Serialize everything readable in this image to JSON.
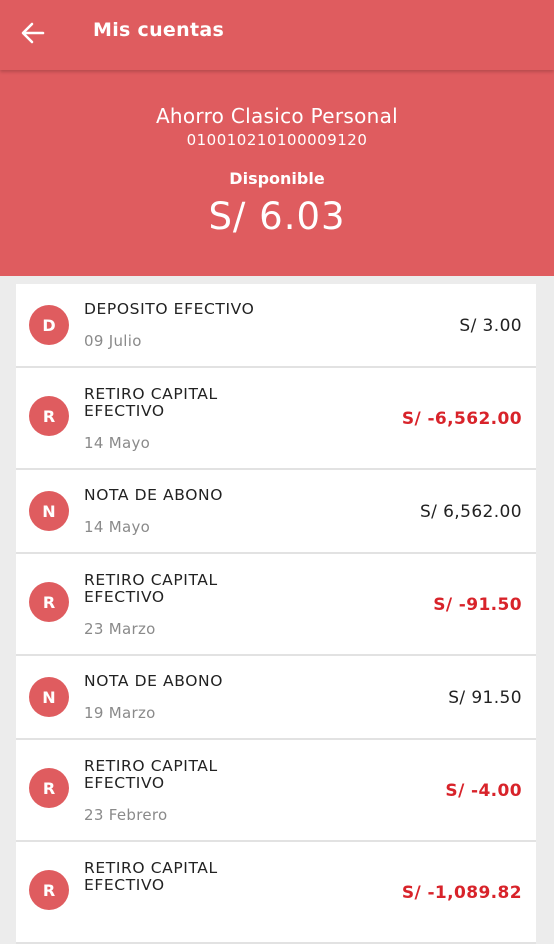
{
  "header": {
    "title": "Mis cuentas",
    "back_icon": "arrow-left-icon"
  },
  "account": {
    "name": "Ahorro Clasico Personal",
    "number": "010010210100009120",
    "available_label": "Disponible",
    "available_amount": "S/ 6.03"
  },
  "colors": {
    "brand": "#df5c5f",
    "negative": "#d8232a"
  },
  "transactions": [
    {
      "initial": "D",
      "description": "DEPOSITO EFECTIVO",
      "date": "09 Julio",
      "amount": "S/ 3.00",
      "negative": false
    },
    {
      "initial": "R",
      "description": "RETIRO CAPITAL EFECTIVO",
      "date": "14 Mayo",
      "amount": "S/ -6,562.00",
      "negative": true
    },
    {
      "initial": "N",
      "description": "NOTA DE ABONO",
      "date": "14 Mayo",
      "amount": "S/ 6,562.00",
      "negative": false
    },
    {
      "initial": "R",
      "description": "RETIRO CAPITAL EFECTIVO",
      "date": "23 Marzo",
      "amount": "S/ -91.50",
      "negative": true
    },
    {
      "initial": "N",
      "description": "NOTA DE ABONO",
      "date": "19 Marzo",
      "amount": "S/ 91.50",
      "negative": false
    },
    {
      "initial": "R",
      "description": "RETIRO CAPITAL EFECTIVO",
      "date": "23 Febrero",
      "amount": "S/ -4.00",
      "negative": true
    },
    {
      "initial": "R",
      "description": "RETIRO CAPITAL EFECTIVO",
      "date": "",
      "amount": "S/ -1,089.82",
      "negative": true
    }
  ]
}
